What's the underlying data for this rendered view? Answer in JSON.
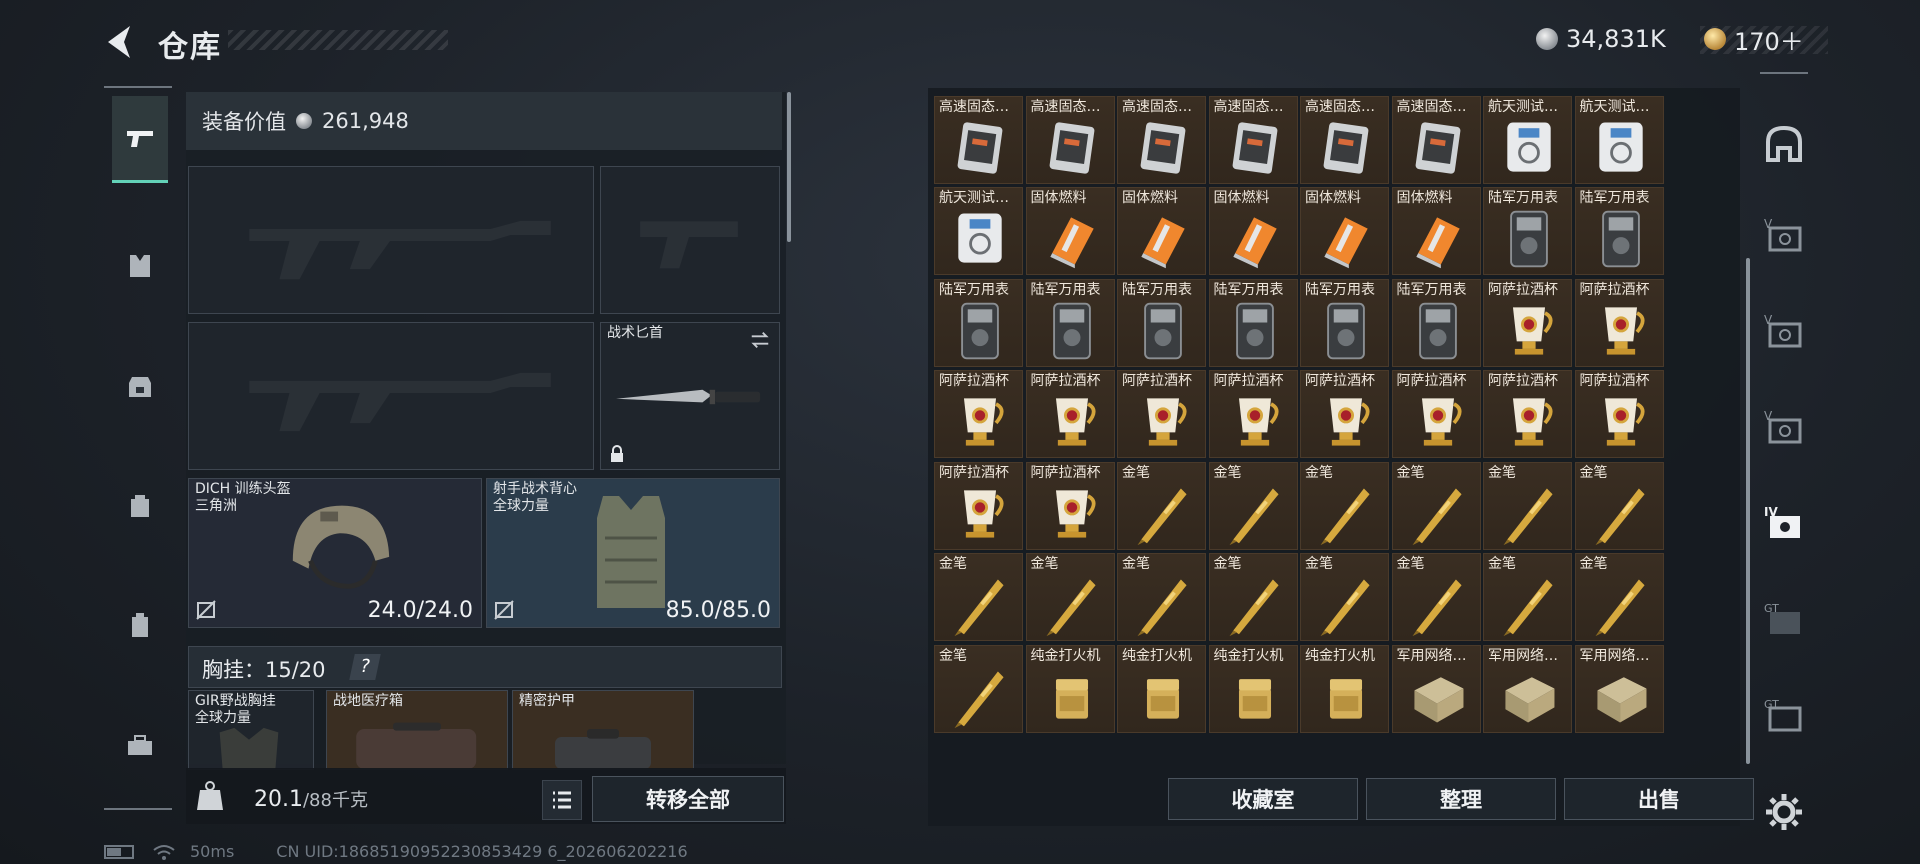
{
  "header": {
    "title": "仓库"
  },
  "currency": {
    "silver": "34,831K",
    "gold": "170＋"
  },
  "equipment": {
    "value_label": "装备价值",
    "value": "261,948",
    "knife_name": "战术匕首",
    "helmet": {
      "name": "DICH 训练头盔",
      "sub": "三角洲",
      "durability": "24.0/24.0"
    },
    "vest": {
      "name": "射手战术背心",
      "sub": "全球力量",
      "durability": "85.0/85.0"
    },
    "chest_label": "胸挂：",
    "chest_count": "15",
    "chest_total": "/20",
    "chest_help": "?",
    "chest_items": [
      {
        "name": "GIR野战胸挂",
        "sub": "全球力量"
      },
      {
        "name": "战地医疗箱",
        "sub": ""
      },
      {
        "name": "精密护甲",
        "sub": ""
      }
    ],
    "weight": "20.1",
    "weight_max": "/88千克",
    "transfer_all": "转移全部"
  },
  "storage": {
    "collection": "收藏室",
    "organize": "整理",
    "sell": "出售",
    "rows": [
      [
        "",
        "",
        "",
        "",
        "",
        "",
        "",
        ""
      ],
      [
        "高速固态…",
        "高速固态…",
        "高速固态…",
        "高速固态…",
        "高速固态…",
        "高速固态…",
        "航天测试…",
        "航天测试…"
      ],
      [
        "航天测试…",
        "固体燃料",
        "固体燃料",
        "固体燃料",
        "固体燃料",
        "固体燃料",
        "陆军万用表",
        "陆军万用表"
      ],
      [
        "陆军万用表",
        "陆军万用表",
        "陆军万用表",
        "陆军万用表",
        "陆军万用表",
        "陆军万用表",
        "阿萨拉酒杯",
        "阿萨拉酒杯"
      ],
      [
        "阿萨拉酒杯",
        "阿萨拉酒杯",
        "阿萨拉酒杯",
        "阿萨拉酒杯",
        "阿萨拉酒杯",
        "阿萨拉酒杯",
        "阿萨拉酒杯",
        "阿萨拉酒杯"
      ],
      [
        "阿萨拉酒杯",
        "阿萨拉酒杯",
        "金笔",
        "金笔",
        "金笔",
        "金笔",
        "金笔",
        "金笔"
      ],
      [
        "金笔",
        "金笔",
        "金笔",
        "金笔",
        "金笔",
        "金笔",
        "金笔",
        "金笔"
      ],
      [
        "金笔",
        "纯金打火机",
        "纯金打火机",
        "纯金打火机",
        "纯金打火机",
        "军用网络…",
        "军用网络…",
        "军用网络…"
      ]
    ],
    "row_icons": [
      [
        "medal",
        "medal",
        "medal",
        "medal",
        "medal",
        "medal",
        "medal",
        "medal"
      ],
      [
        "ssd",
        "ssd",
        "ssd",
        "ssd",
        "ssd",
        "ssd",
        "test",
        "test"
      ],
      [
        "test",
        "fuel",
        "fuel",
        "fuel",
        "fuel",
        "fuel",
        "meter",
        "meter"
      ],
      [
        "meter",
        "meter",
        "meter",
        "meter",
        "meter",
        "meter",
        "cup",
        "cup"
      ],
      [
        "cup",
        "cup",
        "cup",
        "cup",
        "cup",
        "cup",
        "cup",
        "cup"
      ],
      [
        "cup",
        "cup",
        "pen",
        "pen",
        "pen",
        "pen",
        "pen",
        "pen"
      ],
      [
        "pen",
        "pen",
        "pen",
        "pen",
        "pen",
        "pen",
        "pen",
        "pen"
      ],
      [
        "pen",
        "lighter",
        "lighter",
        "lighter",
        "lighter",
        "net",
        "net",
        "net"
      ]
    ]
  },
  "categories": [
    "safehouse-icon",
    "tier-v-icon",
    "tier-v-icon",
    "tier-v-icon",
    "tier-iv-icon",
    "tier-gt-icon",
    "tier-gt-icon"
  ],
  "status": {
    "ping": "50ms",
    "uid": "CN UID:18685190952230853429 6_202606202216"
  }
}
